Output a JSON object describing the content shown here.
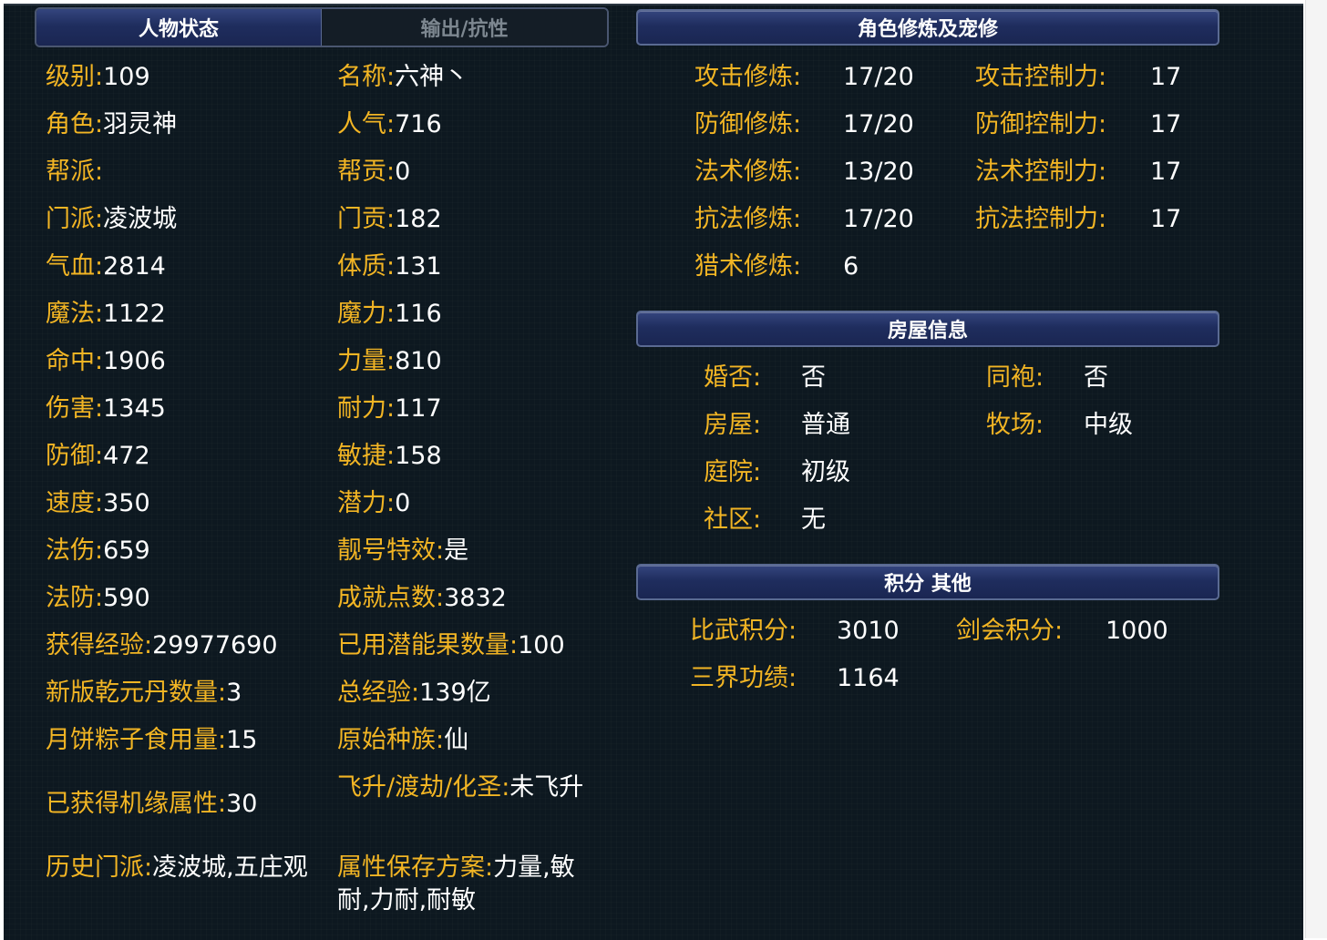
{
  "tabs": {
    "status": "人物状态",
    "output": "输出/抗性"
  },
  "left": {
    "level_k": "级别:",
    "level_v": "109",
    "name_k": "名称:",
    "name_v": "六神丶",
    "role_k": "角色:",
    "role_v": "羽灵神",
    "pop_k": "人气:",
    "pop_v": "716",
    "gang_k": "帮派:",
    "gang_v": "",
    "gangc_k": "帮贡:",
    "gangc_v": "0",
    "sect_k": "门派:",
    "sect_v": "凌波城",
    "sectc_k": "门贡:",
    "sectc_v": "182",
    "hp_k": "气血:",
    "hp_v": "2814",
    "con_k": "体质:",
    "con_v": "131",
    "mp_k": "魔法:",
    "mp_v": "1122",
    "mag_k": "魔力:",
    "mag_v": "116",
    "hit_k": "命中:",
    "hit_v": "1906",
    "str_k": "力量:",
    "str_v": "810",
    "dmg_k": "伤害:",
    "dmg_v": "1345",
    "end_k": "耐力:",
    "end_v": "117",
    "def_k": "防御:",
    "def_v": "472",
    "agi_k": "敏捷:",
    "agi_v": "158",
    "spd_k": "速度:",
    "spd_v": "350",
    "pot_k": "潜力:",
    "pot_v": "0",
    "mdmg_k": "法伤:",
    "mdmg_v": "659",
    "title_k": "靓号特效:",
    "title_v": "是",
    "mdef_k": "法防:",
    "mdef_v": "590",
    "ach_k": "成就点数:",
    "ach_v": "3832",
    "exp_k": "获得经验:",
    "exp_v": "29977690",
    "fruit_k": "已用潜能果数量:",
    "fruit_v": "100",
    "pill_k": "新版乾元丹数量:",
    "pill_v": "3",
    "texp_k": "总经验:",
    "texp_v": "139亿",
    "cake_k": "月饼粽子食用量:",
    "cake_v": "15",
    "race_k": "原始种族:",
    "race_v": "仙",
    "chance_k": "已获得机缘属性:",
    "chance_v": "30",
    "fly_k": "飞升/渡劫/化圣:",
    "fly_v": "未飞升",
    "hist_k": "历史门派:",
    "hist_v": "凌波城,五庄观",
    "plan_k": "属性保存方案:",
    "plan_v": "力量,敏耐,力耐,耐敏"
  },
  "cultivation": {
    "header": "角色修炼及宠修",
    "atk_k": "攻击修炼:",
    "atk_v": "17/20",
    "atkc_k": "攻击控制力:",
    "atkc_v": "17",
    "def_k": "防御修炼:",
    "def_v": "17/20",
    "defc_k": "防御控制力:",
    "defc_v": "17",
    "mag_k": "法术修炼:",
    "mag_v": "13/20",
    "magc_k": "法术控制力:",
    "magc_v": "17",
    "res_k": "抗法修炼:",
    "res_v": "17/20",
    "resc_k": "抗法控制力:",
    "resc_v": "17",
    "hunt_k": "猎术修炼:",
    "hunt_v": "6"
  },
  "house": {
    "header": "房屋信息",
    "marry_k": "婚否:",
    "marry_v": "否",
    "sworn_k": "同袍:",
    "sworn_v": "否",
    "house_k": "房屋:",
    "house_v": "普通",
    "ranch_k": "牧场:",
    "ranch_v": "中级",
    "yard_k": "庭院:",
    "yard_v": "初级",
    "comm_k": "社区:",
    "comm_v": "无"
  },
  "score": {
    "header": "积分 其他",
    "duel_k": "比武积分:",
    "duel_v": "3010",
    "sword_k": "剑会积分:",
    "sword_v": "1000",
    "merit_k": "三界功绩:",
    "merit_v": "1164"
  }
}
